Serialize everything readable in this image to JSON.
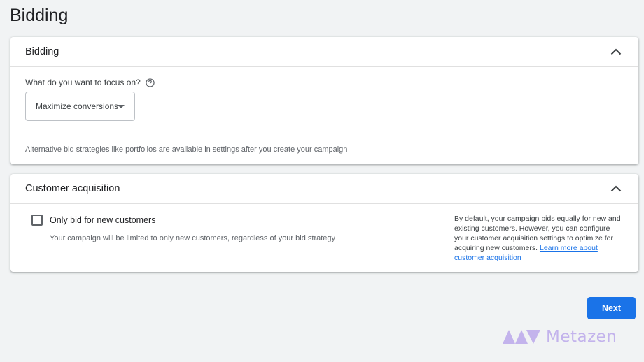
{
  "page": {
    "title": "Bidding"
  },
  "bidding": {
    "title": "Bidding",
    "focus_label": "What do you want to focus on?",
    "select_value": "Maximize conversions",
    "note": "Alternative bid strategies like portfolios are available in settings after you create your campaign"
  },
  "acquisition": {
    "title": "Customer acquisition",
    "checkbox_label": "Only bid for new customers",
    "checkbox_checked": false,
    "checkbox_desc": "Your campaign will be limited to only new customers, regardless of your bid strategy",
    "side_note": "By default, your campaign bids equally for new and existing customers. However, you can configure your customer acquisition settings to optimize for acquiring new customers.",
    "learn_more": "Learn more about customer acquisition"
  },
  "footer": {
    "next_label": "Next"
  },
  "watermark": {
    "text": "Metazen"
  },
  "colors": {
    "accent": "#1a73e8",
    "background": "#f1f3f4",
    "watermark": "#c3b3ec"
  },
  "icons": {
    "collapse": "chevron-up-icon",
    "help": "help-circle-icon",
    "dropdown": "caret-down-icon"
  }
}
